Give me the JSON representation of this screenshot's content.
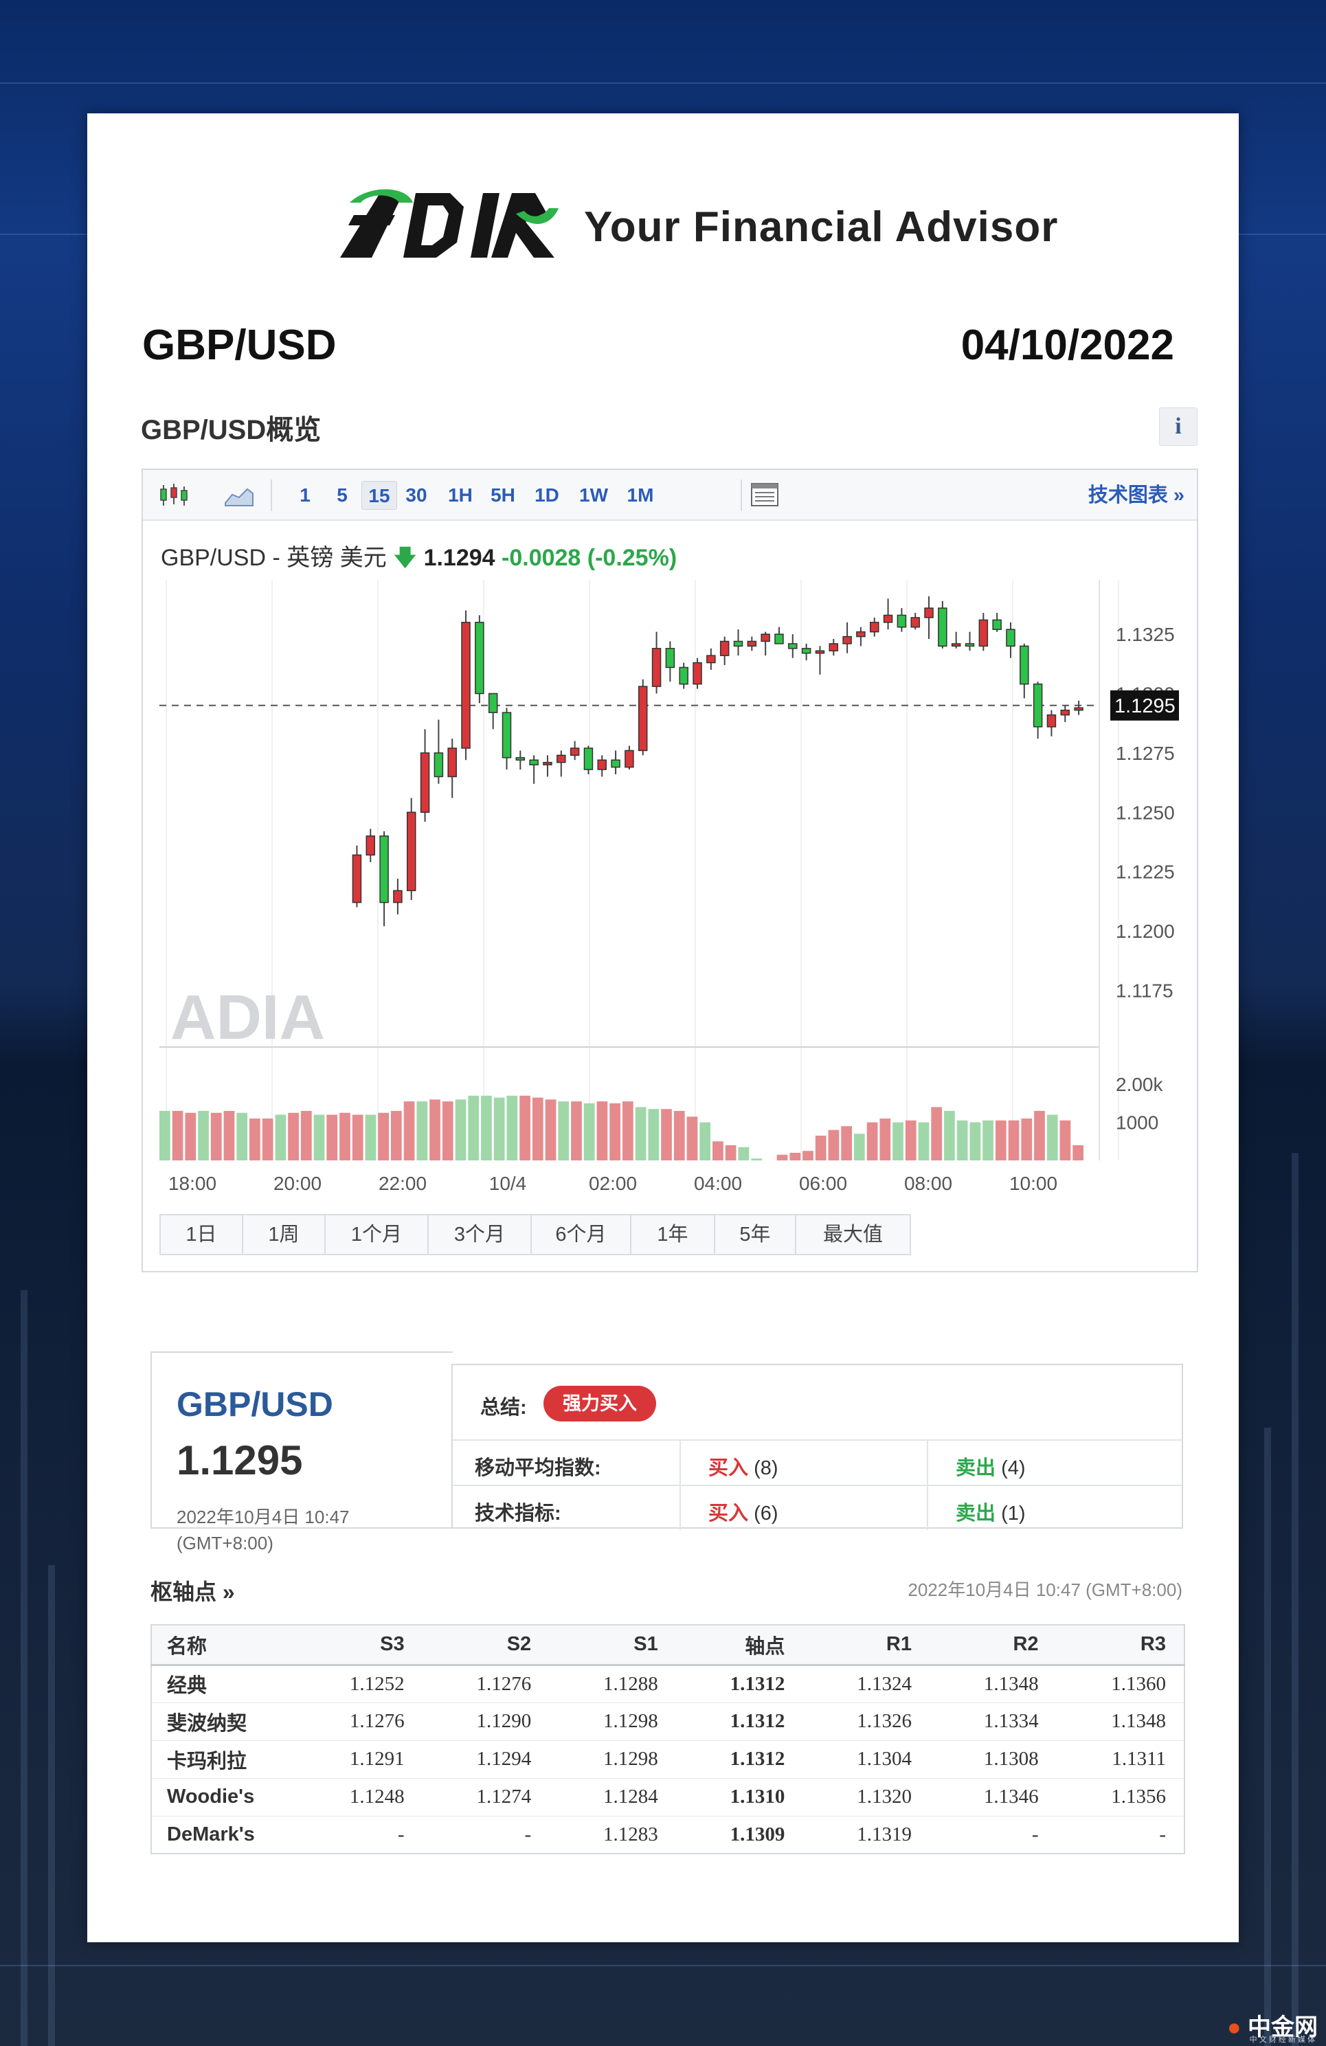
{
  "logo": {
    "tagline": "Your Financial Advisor",
    "colors": {
      "dark": "#161616",
      "green": "#2db34a"
    }
  },
  "header": {
    "pair": "GBP/USD",
    "date": "04/10/2022"
  },
  "overview": {
    "title": "GBP/USD概览",
    "info_label": "i"
  },
  "toolbar": {
    "candle_icon": "candlestick-icon",
    "area_icon": "area-chart-icon",
    "intervals": [
      "1",
      "5",
      "15",
      "30",
      "1H",
      "5H",
      "1D",
      "1W",
      "1M"
    ],
    "active_interval": "15",
    "table_icon": "table-icon",
    "tech_chart_link": "技术图表 »"
  },
  "quote": {
    "name": "GBP/USD - 英镑 美元",
    "price": "1.1294",
    "change": "-0.0028 (-0.25%)",
    "direction": "down"
  },
  "chart_data": {
    "type": "candlestick",
    "title": "GBP/USD - 英镑 美元",
    "y_ticks": [
      "1.1325",
      "1.1300",
      "1.1275",
      "1.1250",
      "1.1225",
      "1.1200",
      "1.1175"
    ],
    "ylim": [
      1.1165,
      1.1345
    ],
    "x_ticks": [
      "18:00",
      "20:00",
      "22:00",
      "10/4",
      "02:00",
      "04:00",
      "06:00",
      "08:00",
      "10:00"
    ],
    "current_price_label": "1.1295",
    "current_price": 1.1295,
    "watermark": "ADIA",
    "up_color": "#d9363a",
    "down_color": "#2ec24a",
    "volume_ticks": [
      "2.00k",
      "1000"
    ],
    "volume_max": 2400,
    "candles": [
      [
        null,
        null,
        null,
        null
      ],
      [
        null,
        null,
        null,
        null
      ],
      [
        null,
        null,
        null,
        null
      ],
      [
        null,
        null,
        null,
        null
      ],
      [
        null,
        null,
        null,
        null
      ],
      [
        null,
        null,
        null,
        null
      ],
      [
        null,
        null,
        null,
        null
      ],
      [
        null,
        null,
        null,
        null
      ],
      [
        null,
        null,
        null,
        null
      ],
      [
        null,
        null,
        null,
        null
      ],
      [
        null,
        null,
        null,
        null
      ],
      [
        null,
        null,
        null,
        null
      ],
      [
        null,
        null,
        null,
        null
      ],
      [
        null,
        null,
        null,
        null
      ],
      [
        1.1212,
        1.1236,
        1.121,
        1.1232
      ],
      [
        1.1232,
        1.1243,
        1.1229,
        1.124
      ],
      [
        1.124,
        1.1242,
        1.1202,
        1.1212
      ],
      [
        1.1212,
        1.1222,
        1.1207,
        1.1217
      ],
      [
        1.1217,
        1.1256,
        1.1213,
        1.125
      ],
      [
        1.125,
        1.1285,
        1.1246,
        1.1275
      ],
      [
        1.1275,
        1.1289,
        1.1262,
        1.1265
      ],
      [
        1.1265,
        1.1281,
        1.1256,
        1.1277
      ],
      [
        1.1277,
        1.1335,
        1.1272,
        1.133
      ],
      [
        1.133,
        1.1333,
        1.1296,
        1.13
      ],
      [
        1.13,
        1.13,
        1.1285,
        1.1292
      ],
      [
        1.1292,
        1.1294,
        1.1268,
        1.1273
      ],
      [
        1.1273,
        1.1276,
        1.1268,
        1.1272
      ],
      [
        1.1272,
        1.1274,
        1.1262,
        1.127
      ],
      [
        1.127,
        1.1274,
        1.1265,
        1.1271
      ],
      [
        1.1271,
        1.1276,
        1.1265,
        1.1274
      ],
      [
        1.1274,
        1.128,
        1.1272,
        1.1277
      ],
      [
        1.1277,
        1.1278,
        1.1266,
        1.1268
      ],
      [
        1.1268,
        1.1274,
        1.1265,
        1.1272
      ],
      [
        1.1272,
        1.1276,
        1.1266,
        1.1269
      ],
      [
        1.1269,
        1.1278,
        1.1268,
        1.1276
      ],
      [
        1.1276,
        1.1306,
        1.1274,
        1.1303
      ],
      [
        1.1303,
        1.1326,
        1.13,
        1.1319
      ],
      [
        1.1319,
        1.1322,
        1.1305,
        1.1311
      ],
      [
        1.1311,
        1.1313,
        1.1302,
        1.1304
      ],
      [
        1.1304,
        1.1315,
        1.1302,
        1.1313
      ],
      [
        1.1313,
        1.1319,
        1.131,
        1.1316
      ],
      [
        1.1316,
        1.1324,
        1.1312,
        1.1322
      ],
      [
        1.1322,
        1.1327,
        1.1316,
        1.132
      ],
      [
        1.132,
        1.1324,
        1.1318,
        1.1322
      ],
      [
        1.1322,
        1.1326,
        1.1316,
        1.1325
      ],
      [
        1.1325,
        1.1328,
        1.1321,
        1.1321
      ],
      [
        1.1321,
        1.1325,
        1.1315,
        1.1319
      ],
      [
        1.1319,
        1.1321,
        1.1314,
        1.1317
      ],
      [
        1.1317,
        1.132,
        1.1308,
        1.1318
      ],
      [
        1.1318,
        1.1323,
        1.1316,
        1.1321
      ],
      [
        1.1321,
        1.133,
        1.1317,
        1.1324
      ],
      [
        1.1324,
        1.1328,
        1.132,
        1.1326
      ],
      [
        1.1326,
        1.1332,
        1.1324,
        1.133
      ],
      [
        1.133,
        1.134,
        1.1327,
        1.1333
      ],
      [
        1.1333,
        1.1336,
        1.1326,
        1.1328
      ],
      [
        1.1328,
        1.1334,
        1.1327,
        1.1332
      ],
      [
        1.1332,
        1.1341,
        1.1323,
        1.1336
      ],
      [
        1.1336,
        1.1339,
        1.1319,
        1.132
      ],
      [
        1.132,
        1.1326,
        1.1319,
        1.1321
      ],
      [
        1.1321,
        1.1326,
        1.1318,
        1.132
      ],
      [
        1.132,
        1.1334,
        1.1318,
        1.1331
      ],
      [
        1.1331,
        1.1334,
        1.1326,
        1.1327
      ],
      [
        1.1327,
        1.133,
        1.1315,
        1.132
      ],
      [
        1.132,
        1.1321,
        1.1298,
        1.1304
      ],
      [
        1.1304,
        1.1305,
        1.1281,
        1.1286
      ],
      [
        1.1286,
        1.1293,
        1.1282,
        1.1291
      ],
      [
        1.1291,
        1.1295,
        1.1288,
        1.1293
      ],
      [
        1.1293,
        1.1297,
        1.1291,
        1.1294
      ]
    ],
    "volume": [
      1300,
      1300,
      1250,
      1300,
      1250,
      1300,
      1250,
      1100,
      1100,
      1200,
      1250,
      1300,
      1200,
      1200,
      1250,
      1200,
      1200,
      1250,
      1300,
      1550,
      1550,
      1600,
      1550,
      1600,
      1700,
      1700,
      1650,
      1700,
      1700,
      1650,
      1600,
      1550,
      1550,
      1500,
      1550,
      1500,
      1550,
      1400,
      1350,
      1350,
      1300,
      1150,
      1000,
      500,
      400,
      350,
      50,
      0,
      150,
      200,
      250,
      650,
      800,
      900,
      700,
      1000,
      1100,
      1000,
      1050,
      1000,
      1400,
      1300,
      1050,
      1000,
      1050,
      1050,
      1050,
      1100,
      1300,
      1200,
      1050,
      400
    ]
  },
  "ranges": [
    "1日",
    "1周",
    "1个月",
    "3个月",
    "6个月",
    "1年",
    "5年",
    "最大值"
  ],
  "summary": {
    "pair": "GBP/USD",
    "price": "1.1295",
    "time": "2022年10月4日 10:47 (GMT+8:00)",
    "total_label": "总结:",
    "total_value": "强力买入",
    "ma_label": "移动平均指数:",
    "ma_buy": "买入",
    "ma_buy_count": "(8)",
    "ma_sell": "卖出",
    "ma_sell_count": "(4)",
    "ti_label": "技术指标:",
    "ti_buy": "买入",
    "ti_buy_count": "(6)",
    "ti_sell": "卖出",
    "ti_sell_count": "(1)",
    "colors": {
      "buy": "#d9363a",
      "sell": "#2aa84a"
    }
  },
  "pivot": {
    "title": "枢轴点 »",
    "time": "2022年10月4日 10:47 (GMT+8:00)",
    "headers": [
      "名称",
      "S3",
      "S2",
      "S1",
      "轴点",
      "R1",
      "R2",
      "R3"
    ],
    "rows": [
      [
        "经典",
        "1.1252",
        "1.1276",
        "1.1288",
        "1.1312",
        "1.1324",
        "1.1348",
        "1.1360"
      ],
      [
        "斐波纳契",
        "1.1276",
        "1.1290",
        "1.1298",
        "1.1312",
        "1.1326",
        "1.1334",
        "1.1348"
      ],
      [
        "卡玛利拉",
        "1.1291",
        "1.1294",
        "1.1298",
        "1.1312",
        "1.1304",
        "1.1308",
        "1.1311"
      ],
      [
        "Woodie's",
        "1.1248",
        "1.1274",
        "1.1284",
        "1.1310",
        "1.1320",
        "1.1346",
        "1.1356"
      ],
      [
        "DeMark's",
        "-",
        "-",
        "1.1283",
        "1.1309",
        "1.1319",
        "-",
        "-"
      ]
    ]
  },
  "footer": {
    "brand": "中金网",
    "brand_sub": "中 文 财 经 新 媒 体"
  }
}
